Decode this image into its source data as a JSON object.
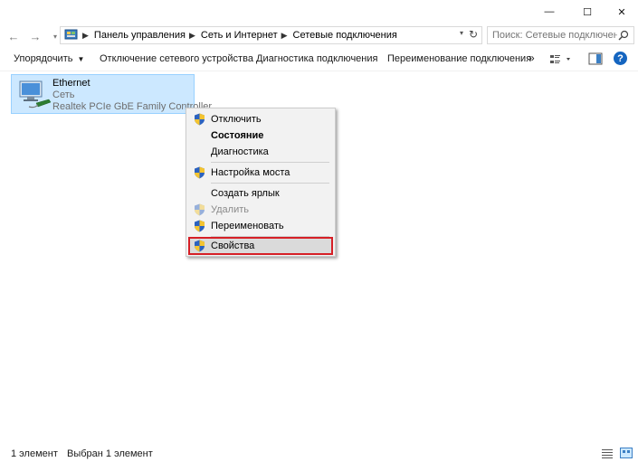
{
  "window": {
    "minimize_glyph": "—",
    "maximize_glyph": "☐",
    "close_glyph": "✕"
  },
  "address": {
    "breadcrumbs": [
      "Панель управления",
      "Сеть и Интернет",
      "Сетевые подключения"
    ],
    "search_placeholder": "Поиск: Сетевые подключения"
  },
  "commands": {
    "organize": "Упорядочить",
    "disable": "Отключение сетевого устройства",
    "diagnose": "Диагностика подключения",
    "rename": "Переименование подключения",
    "more": "»",
    "help": "?"
  },
  "connection": {
    "name": "Ethernet",
    "network": "Сеть",
    "adapter": "Realtek PCIe GbE Family Controller"
  },
  "context_menu": {
    "items": [
      {
        "label": "Отключить",
        "icon": "uac-shield-icon"
      },
      {
        "label": "Состояние",
        "bold": true
      },
      {
        "label": "Диагностика"
      },
      {
        "label": "Настройка моста",
        "icon": "uac-shield-icon"
      },
      {
        "label": "Создать ярлык"
      },
      {
        "label": "Удалить",
        "icon": "uac-shield-icon",
        "disabled": true
      },
      {
        "label": "Переименовать",
        "icon": "uac-shield-icon"
      },
      {
        "label": "Свойства",
        "icon": "uac-shield-icon",
        "highlighted": true
      }
    ]
  },
  "status": {
    "count": "1 элемент",
    "selected": "Выбран 1 элемент"
  },
  "colors": {
    "selection_bg": "#cce8ff",
    "selection_border": "#99d1ff",
    "highlight_outline": "#d61f26",
    "help_blue": "#1565c0"
  }
}
